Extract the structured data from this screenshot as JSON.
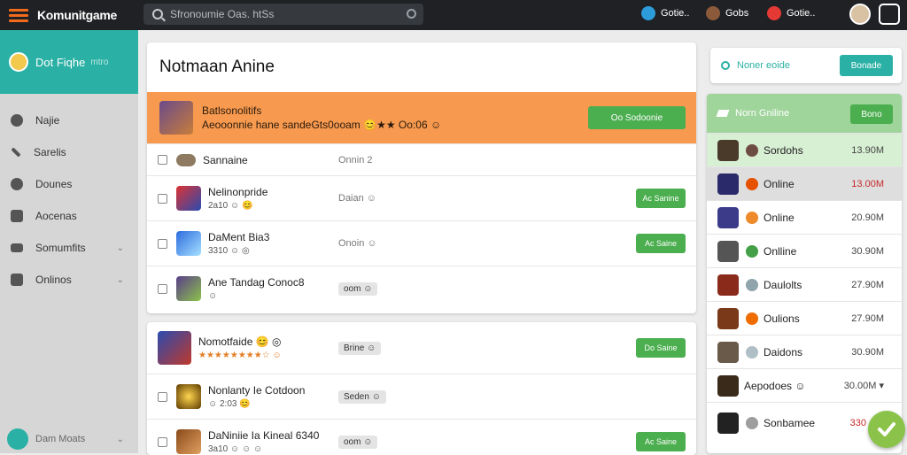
{
  "topbar": {
    "brand": "Komunitgame",
    "search_placeholder": "Sfronoumie Oas. htSs",
    "item1": "Gotie..",
    "item2": "Gobs",
    "item3": "Gotie.."
  },
  "sidebar": {
    "header_name": "Dot Fiqhe",
    "header_sub": "mtro",
    "items": [
      {
        "label": "Najie",
        "icon": "user-icon",
        "chevron": false
      },
      {
        "label": "Sarelis",
        "icon": "wrench-icon",
        "chevron": false
      },
      {
        "label": "Dounes",
        "icon": "disc-icon",
        "chevron": false
      },
      {
        "label": "Aocenas",
        "icon": "briefcase-icon",
        "chevron": false
      },
      {
        "label": "Somumfits",
        "icon": "folder-icon",
        "chevron": true
      },
      {
        "label": "Onlinos",
        "icon": "lock-icon",
        "chevron": true
      }
    ],
    "footer": "Dam Moats"
  },
  "main": {
    "title": "Notmaan Anine",
    "featured": {
      "title": "Batlsonolitifs",
      "subtitle": "Aeooonnie hane sandeGts0ooam 😊★★ Oo:06 ☺",
      "button": "Oo Sodoonie"
    },
    "rows": [
      {
        "name": "Sannaine",
        "sub": "",
        "mid": "Onnin 2",
        "mid_type": "text",
        "button": ""
      },
      {
        "name": "Nelinonpride",
        "sub": "2a10 ☺ 😊",
        "mid": "Daian ☺",
        "mid_type": "text",
        "button": "Ac Sanine"
      },
      {
        "name": "DaMent Bia3",
        "sub": "3310 ☺ ◎",
        "mid": "Onoin ☺",
        "mid_type": "text",
        "button": "Ac Saine"
      },
      {
        "name": "Ane Tandag Conoc8",
        "sub": "☺",
        "mid": "oom ☺",
        "mid_type": "pill",
        "button": ""
      }
    ]
  },
  "main2": {
    "rows": [
      {
        "name": "Nomotfaide 😊 ◎",
        "sub": "★★★★★★★★☆ ☺",
        "mid": "Brine ☺",
        "mid_type": "pill",
        "button": "Do Saine"
      },
      {
        "name": "Nonlanty Ie Cotdoon",
        "sub": "☺ 2:03 😊",
        "mid": "Seden ☺",
        "mid_type": "pill",
        "button": ""
      },
      {
        "name": "DaNiniie Ia Kineal 6340",
        "sub": "3a10 ☺ ☺ ☺",
        "mid": "oom ☺",
        "mid_type": "pill",
        "button": "Ac Saine"
      }
    ]
  },
  "right": {
    "top_search": "Noner eoide",
    "top_button": "Bonade",
    "header_label": "Norn Gniline",
    "header_button": "Bono",
    "rows": [
      {
        "status": "Sordohs",
        "value": "13.90M"
      },
      {
        "status": "Online",
        "value": "13.00M"
      },
      {
        "status": "Online",
        "value": "20.90M"
      },
      {
        "status": "Onlline",
        "value": "30.90M"
      },
      {
        "status": "Daulolts",
        "value": "27.90M"
      },
      {
        "status": "Oulions",
        "value": "27.90M"
      },
      {
        "status": "Daidons",
        "value": "30.90M"
      },
      {
        "status": "Aepodoes ☺",
        "value": "30.00M ▾"
      },
      {
        "status": "Sonbamee",
        "value": "330"
      }
    ]
  },
  "colors": {
    "topbar": "#1f2124",
    "accent_orange": "#f79a4f",
    "teal": "#2ab0a4",
    "green": "#4bae4f"
  }
}
